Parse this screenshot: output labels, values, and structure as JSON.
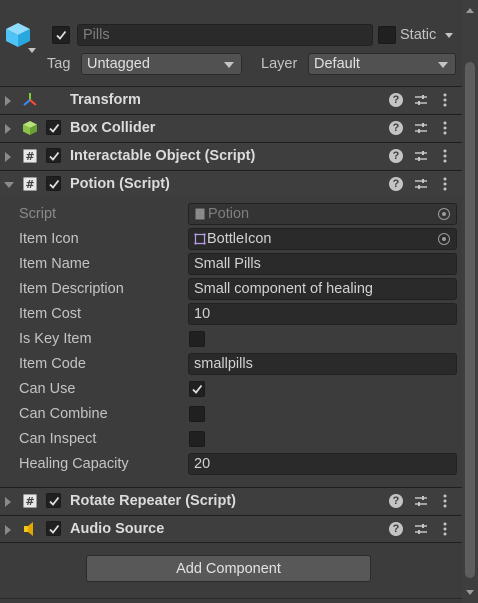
{
  "header": {
    "object_name_placeholder": "Pills",
    "static_label": "Static",
    "tag_label": "Tag",
    "tag_value": "Untagged",
    "layer_label": "Layer",
    "layer_value": "Default",
    "active": true
  },
  "components": [
    {
      "title": "Transform",
      "icon": "transform-icon",
      "has_checkbox": false,
      "expanded": false
    },
    {
      "title": "Box Collider",
      "icon": "box-collider-icon",
      "has_checkbox": true,
      "checked": true,
      "expanded": false
    },
    {
      "title": "Interactable Object (Script)",
      "icon": "script-icon",
      "has_checkbox": true,
      "checked": true,
      "expanded": false
    },
    {
      "title": "Potion (Script)",
      "icon": "script-icon",
      "has_checkbox": true,
      "checked": true,
      "expanded": true
    },
    {
      "title": "Rotate Repeater (Script)",
      "icon": "script-icon",
      "has_checkbox": true,
      "checked": true,
      "expanded": false
    },
    {
      "title": "Audio Source",
      "icon": "audio-source-icon",
      "has_checkbox": true,
      "checked": true,
      "expanded": false
    }
  ],
  "potion": {
    "script": {
      "label": "Script",
      "value": "Potion"
    },
    "item_icon": {
      "label": "Item Icon",
      "value": "BottleIcon"
    },
    "item_name": {
      "label": "Item Name",
      "value": "Small Pills"
    },
    "item_description": {
      "label": "Item Description",
      "value": "Small component of healing"
    },
    "item_cost": {
      "label": "Item Cost",
      "value": "10"
    },
    "is_key_item": {
      "label": "Is Key Item",
      "checked": false
    },
    "item_code": {
      "label": "Item Code",
      "value": "smallpills"
    },
    "can_use": {
      "label": "Can Use",
      "checked": true
    },
    "can_combine": {
      "label": "Can Combine",
      "checked": false
    },
    "can_inspect": {
      "label": "Can Inspect",
      "checked": false
    },
    "healing_capacity": {
      "label": "Healing Capacity",
      "value": "20"
    }
  },
  "add_component_label": "Add Component",
  "colors": {
    "background": "#3c3c3c",
    "field": "#2a2a2a",
    "text": "#c4c4c4",
    "accent_cube": "#4fc3f7",
    "box_collider_green": "#8bc34a",
    "audio_yellow": "#f5c518"
  }
}
